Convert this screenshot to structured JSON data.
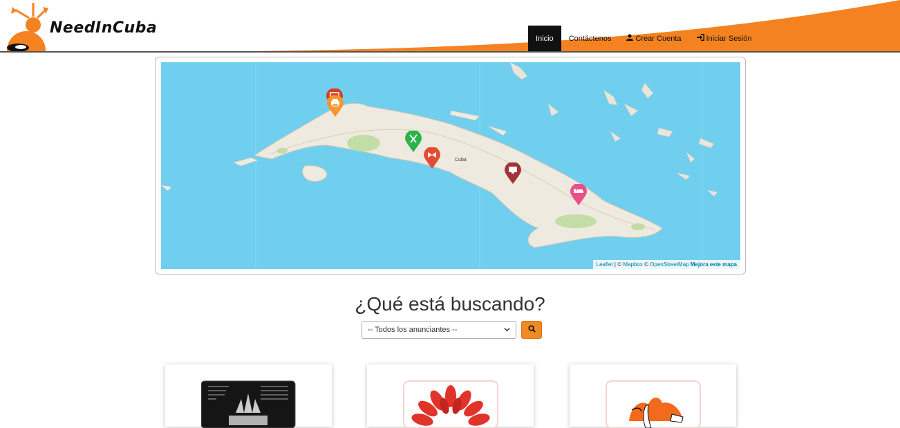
{
  "brand": {
    "name": "NeedInCuba",
    "primary_color": "#f58220",
    "dark_color": "#111111"
  },
  "nav": {
    "items": [
      {
        "label": "Inicio",
        "icon": "",
        "active": true
      },
      {
        "label": "Contáctenos",
        "icon": ""
      },
      {
        "label": "Crear Cuenta",
        "icon": "user-icon"
      },
      {
        "label": "Iniciar Sesión",
        "icon": "sign-in-icon"
      }
    ]
  },
  "map": {
    "attribution": {
      "leaflet": "Leaflet",
      "sep1": " | © ",
      "mapbox": "Mapbox",
      "sep2": " © ",
      "osm": "OpenStreetMap",
      "improve": "Mejora este mapa"
    },
    "label_cuba": "Cuba",
    "markers": [
      {
        "name": "marker-computer-red",
        "color": "#d63e2a",
        "icon": "monitor-icon"
      },
      {
        "name": "marker-printer-orange",
        "color": "#f69730",
        "icon": "printer-icon"
      },
      {
        "name": "marker-restaurant-green",
        "color": "#2bb34b",
        "icon": "utensils-icon"
      },
      {
        "name": "marker-gift-red",
        "color": "#e24e33",
        "icon": "bowtie-icon"
      },
      {
        "name": "marker-computer-darkred",
        "color": "#a23336",
        "icon": "monitor-icon"
      },
      {
        "name": "marker-bed-pink",
        "color": "#ea4f8a",
        "icon": "bed-icon"
      }
    ]
  },
  "search": {
    "title": "¿Qué está buscando?",
    "select_value": "-- Todos los anunciantes --"
  }
}
